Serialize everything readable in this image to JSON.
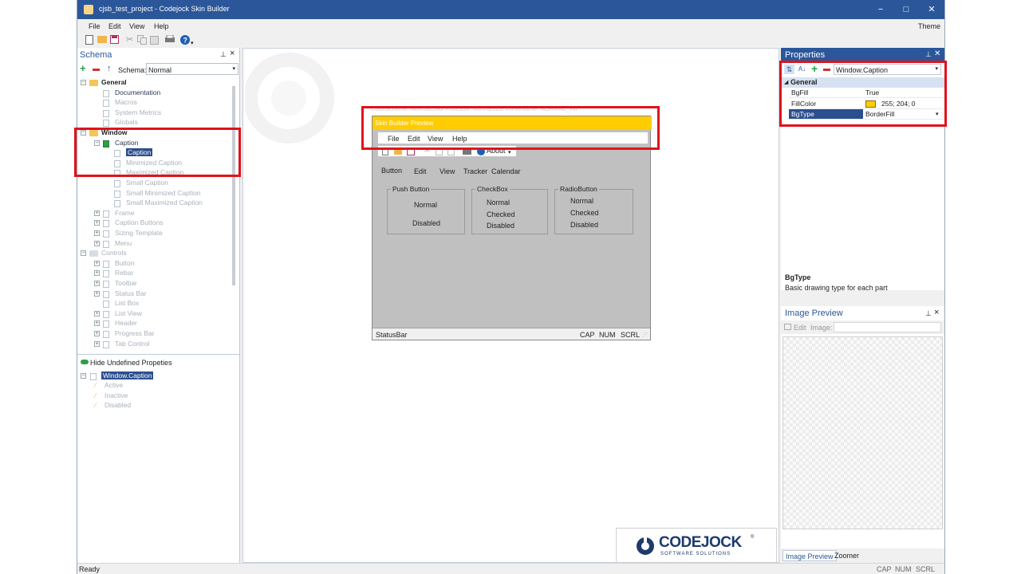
{
  "window": {
    "title": "cjsb_test_project - Codejock Skin Builder",
    "minimize": "−",
    "maximize": "□",
    "close": "✕",
    "accent": "#2b579a"
  },
  "menu": {
    "items": [
      "File",
      "Edit",
      "View",
      "Help"
    ],
    "theme": "Theme"
  },
  "toolbar": {
    "icons": [
      "new-icon",
      "open-icon",
      "save-icon",
      "cut-icon",
      "copy-icon",
      "paste-icon",
      "print-icon",
      "help-icon"
    ]
  },
  "schema": {
    "title": "Schema",
    "pin": "⊥",
    "close": "×",
    "schema_label": "Schema:",
    "schema_value": "Normal",
    "tree": [
      {
        "label": "General",
        "level": 0,
        "style": "bold",
        "expander": "−",
        "icon": "folder"
      },
      {
        "label": "Documentation",
        "level": 1,
        "style": "en",
        "icon": "doc"
      },
      {
        "label": "Macros",
        "level": 1,
        "style": "dis",
        "icon": "doc"
      },
      {
        "label": "System Metrics",
        "level": 1,
        "style": "dis",
        "icon": "doc"
      },
      {
        "label": "Globals",
        "level": 1,
        "style": "dis",
        "icon": "doc"
      },
      {
        "label": "Window",
        "level": 0,
        "style": "bold",
        "expander": "−",
        "icon": "folder"
      },
      {
        "label": "Caption",
        "level": 1,
        "style": "en",
        "expander": "−",
        "icon": "check"
      },
      {
        "label": "Caption",
        "level": 2,
        "style": "selected",
        "icon": "doc"
      },
      {
        "label": "Minimized Caption",
        "level": 2,
        "style": "dis",
        "icon": "doc"
      },
      {
        "label": "Maximized Caption",
        "level": 2,
        "style": "dis",
        "icon": "doc"
      },
      {
        "label": "Small Caption",
        "level": 2,
        "style": "dis",
        "icon": "doc"
      },
      {
        "label": "Small Minimized Caption",
        "level": 2,
        "style": "dis",
        "icon": "doc"
      },
      {
        "label": "Small Maximized Caption",
        "level": 2,
        "style": "dis",
        "icon": "doc"
      },
      {
        "label": "Frame",
        "level": 1,
        "style": "dis",
        "expander": "+",
        "icon": "doc"
      },
      {
        "label": "Caption Buttons",
        "level": 1,
        "style": "dis",
        "expander": "+",
        "icon": "doc"
      },
      {
        "label": "Sizing Template",
        "level": 1,
        "style": "dis",
        "expander": "+",
        "icon": "doc"
      },
      {
        "label": "Menu",
        "level": 1,
        "style": "dis",
        "expander": "+",
        "icon": "doc"
      },
      {
        "label": "Controls",
        "level": 0,
        "style": "dis",
        "expander": "−",
        "icon": "folder-grey"
      },
      {
        "label": "Button",
        "level": 1,
        "style": "dis",
        "expander": "+",
        "icon": "doc"
      },
      {
        "label": "Rebar",
        "level": 1,
        "style": "dis",
        "expander": "+",
        "icon": "doc"
      },
      {
        "label": "Toolbar",
        "level": 1,
        "style": "dis",
        "expander": "+",
        "icon": "doc"
      },
      {
        "label": "Status Bar",
        "level": 1,
        "style": "dis",
        "expander": "+",
        "icon": "doc"
      },
      {
        "label": "List Box",
        "level": 1,
        "style": "dis",
        "icon": "doc"
      },
      {
        "label": "List View",
        "level": 1,
        "style": "dis",
        "expander": "+",
        "icon": "doc"
      },
      {
        "label": "Header",
        "level": 1,
        "style": "dis",
        "expander": "+",
        "icon": "doc"
      },
      {
        "label": "Progress Bar",
        "level": 1,
        "style": "dis",
        "expander": "+",
        "icon": "doc"
      },
      {
        "label": "Tab Control",
        "level": 1,
        "style": "dis",
        "expander": "+",
        "icon": "doc"
      }
    ],
    "hide_undefined": "Hide Undefined Propeties",
    "states_root": "Window.Caption",
    "states": [
      "Active",
      "Inactive",
      "Disabled"
    ]
  },
  "preview": {
    "header_text": "ColorScheme: NormalColor FontSize: NormalSize IniFileName: NORMAL_INI",
    "caption": "Skin Builder Preview",
    "menu": [
      "File",
      "Edit",
      "View",
      "Help"
    ],
    "about": "About",
    "tabs": [
      "Button",
      "Edit",
      "View",
      "Tracker",
      "Calendar"
    ],
    "push": {
      "title": "Push Button",
      "items": [
        "Normal",
        "Disabled"
      ]
    },
    "check": {
      "title": "CheckBox",
      "items": [
        "Normal",
        "Checked",
        "Disabled"
      ]
    },
    "radio": {
      "title": "RadioButton",
      "items": [
        "Normal",
        "Checked",
        "Disabled"
      ]
    },
    "status": {
      "label": "StatusBar",
      "cap": "CAP",
      "num": "NUM",
      "scrl": "SCRL"
    }
  },
  "properties": {
    "title": "Properties",
    "pin": "⊥",
    "close": "✕",
    "object": "Window.Caption",
    "category": "General",
    "rows": [
      {
        "name": "BgFill",
        "value": "True"
      },
      {
        "name": "FillColor",
        "value": "255; 204; 0",
        "swatch": "#ffcc00"
      },
      {
        "name": "BgType",
        "value": "BorderFill",
        "selected": true
      }
    ],
    "desc_title": "BgType",
    "desc_text": "Basic drawing type for each part"
  },
  "image_preview": {
    "title": "Image Preview",
    "pin": "⊥",
    "close": "×",
    "edit": "Edit",
    "image_label": "Image:",
    "tabs": [
      "Image Preview",
      "Zoomer"
    ]
  },
  "logo": {
    "main": "CODEJOCK",
    "sub": "SOFTWARE SOLUTIONS",
    "mark": "®"
  },
  "status": {
    "ready": "Ready",
    "cap": "CAP",
    "num": "NUM",
    "scrl": "SCRL"
  }
}
